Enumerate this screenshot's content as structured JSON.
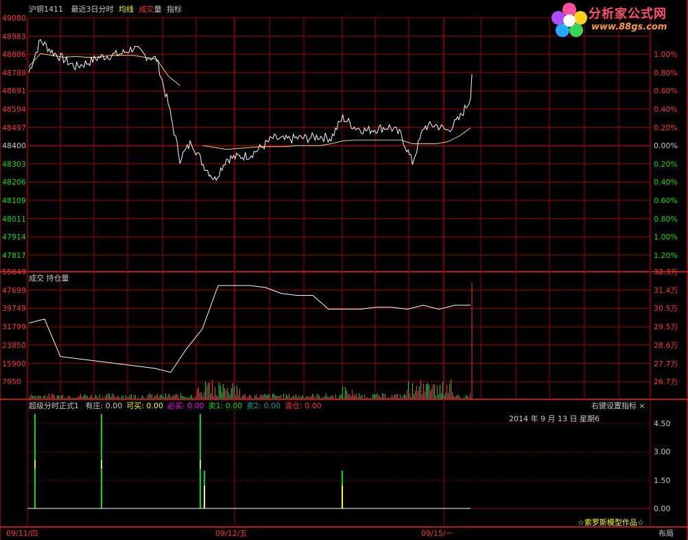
{
  "header": {
    "symbol": "沪铜1411",
    "period": "最近3日分时",
    "avg_label": "均线",
    "vol_label_1": "成交",
    "vol_label_2": "量",
    "ind_label": "指标"
  },
  "logo": {
    "title": "分析家公式网",
    "url": "www.88gs.com"
  },
  "price_panel": {
    "left_ticks": [
      "49080",
      "48983",
      "48886",
      "48789",
      "48691",
      "48594",
      "48497",
      "48400",
      "48303",
      "48206",
      "48109",
      "48011",
      "47914",
      "47817"
    ],
    "right_ticks": [
      "1.00%",
      "0.80%",
      "0.60%",
      "0.40%",
      "0.20%",
      "0.00%",
      "0.20%",
      "0.40%",
      "0.60%",
      "0.80%",
      "1.00%",
      "1.20%"
    ]
  },
  "volume_panel": {
    "title": "成交 持仓量",
    "left_ticks": [
      "55649",
      "47699",
      "39749",
      "31799",
      "23850",
      "15900",
      "7950"
    ],
    "right_ticks": [
      "32.3万",
      "31.4万",
      "30.5万",
      "29.5万",
      "28.6万",
      "27.7万",
      "26.7万"
    ]
  },
  "indicator_panel": {
    "name": "超级分时正式1",
    "items": [
      {
        "label": "有庄:",
        "value": "0.00",
        "color": "#c8c8c8"
      },
      {
        "label": "可买:",
        "value": "0.00",
        "color": "#ffff00"
      },
      {
        "label": "必买:",
        "value": "0.00",
        "color": "#ff00ff"
      },
      {
        "label": "卖1:",
        "value": "0.00",
        "color": "#00e000"
      },
      {
        "label": "卖2:",
        "value": "0.00",
        "color": "#00a0a0"
      },
      {
        "label": "清仓:",
        "value": "0.00",
        "color": "#ff3030"
      }
    ],
    "right_btn": "右键设置指标",
    "close": "×",
    "date": "2014 年 9 月 13 日 星期6",
    "right_ticks": [
      "4.50",
      "3.00",
      "1.50",
      "0.00"
    ],
    "credit": "☆索罗斯模型作品☆"
  },
  "x_axis": {
    "dates": [
      "09/11/四",
      "09/12/五",
      "09/15/一"
    ],
    "layout_btn": "布局"
  },
  "colors": {
    "up": "#ff3030",
    "down": "#00e000",
    "grid": "#a00000",
    "price": "#ffffff",
    "avg": "#e8d870"
  },
  "chart_data": [
    {
      "type": "line",
      "title": "",
      "ylim": [
        47817,
        49080
      ],
      "series": [
        {
          "name": "",
          "values": [
            48790,
            48960,
            48900,
            48860,
            48820,
            48840,
            48870,
            48880,
            48890,
            48920,
            48880,
            48860,
            48620,
            48330,
            48420,
            48300,
            48220,
            48330,
            48340,
            48350,
            48390,
            48440,
            48430,
            48440,
            48440,
            48450,
            48440,
            48550,
            48500,
            48480,
            48490,
            48500,
            48460,
            48310,
            48500,
            48510,
            48480,
            48540,
            48650
          ]
        },
        {
          "name": "均线",
          "values": [
            48820,
            48890,
            48880,
            48870,
            48875,
            48870,
            48870,
            48880,
            48880,
            48880,
            48870,
            48860,
            48770,
            48720,
            null,
            48400,
            48390,
            48380,
            48385,
            48390,
            48395,
            48395,
            48395,
            48400,
            48400,
            48400,
            48410,
            48425,
            48430,
            48430,
            48430,
            48430,
            48430,
            48410,
            48410,
            48410,
            48420,
            48450,
            48495
          ]
        }
      ]
    },
    {
      "type": "line",
      "title": "成交 持仓量",
      "series": [
        {
          "name": "持仓量",
          "values": [
            29.7,
            29.9,
            28.0,
            27.9,
            27.8,
            27.7,
            27.6,
            27.5,
            27.4,
            27.2,
            28.4,
            29.4,
            31.6,
            31.6,
            31.6,
            31.5,
            31.2,
            31.1,
            31.1,
            30.4,
            30.4,
            30.4,
            30.5,
            30.5,
            30.4,
            30.6,
            30.4,
            30.6,
            30.6
          ]
        }
      ]
    },
    {
      "type": "bar",
      "title": "超级分时正式1",
      "ylim": [
        0,
        4.5
      ],
      "series": [
        {
          "name": "有庄",
          "values": [
            5,
            5,
            5,
            2,
            2
          ]
        },
        {
          "name": "可买",
          "values": [
            0,
            0,
            0,
            2,
            2
          ]
        }
      ]
    }
  ]
}
